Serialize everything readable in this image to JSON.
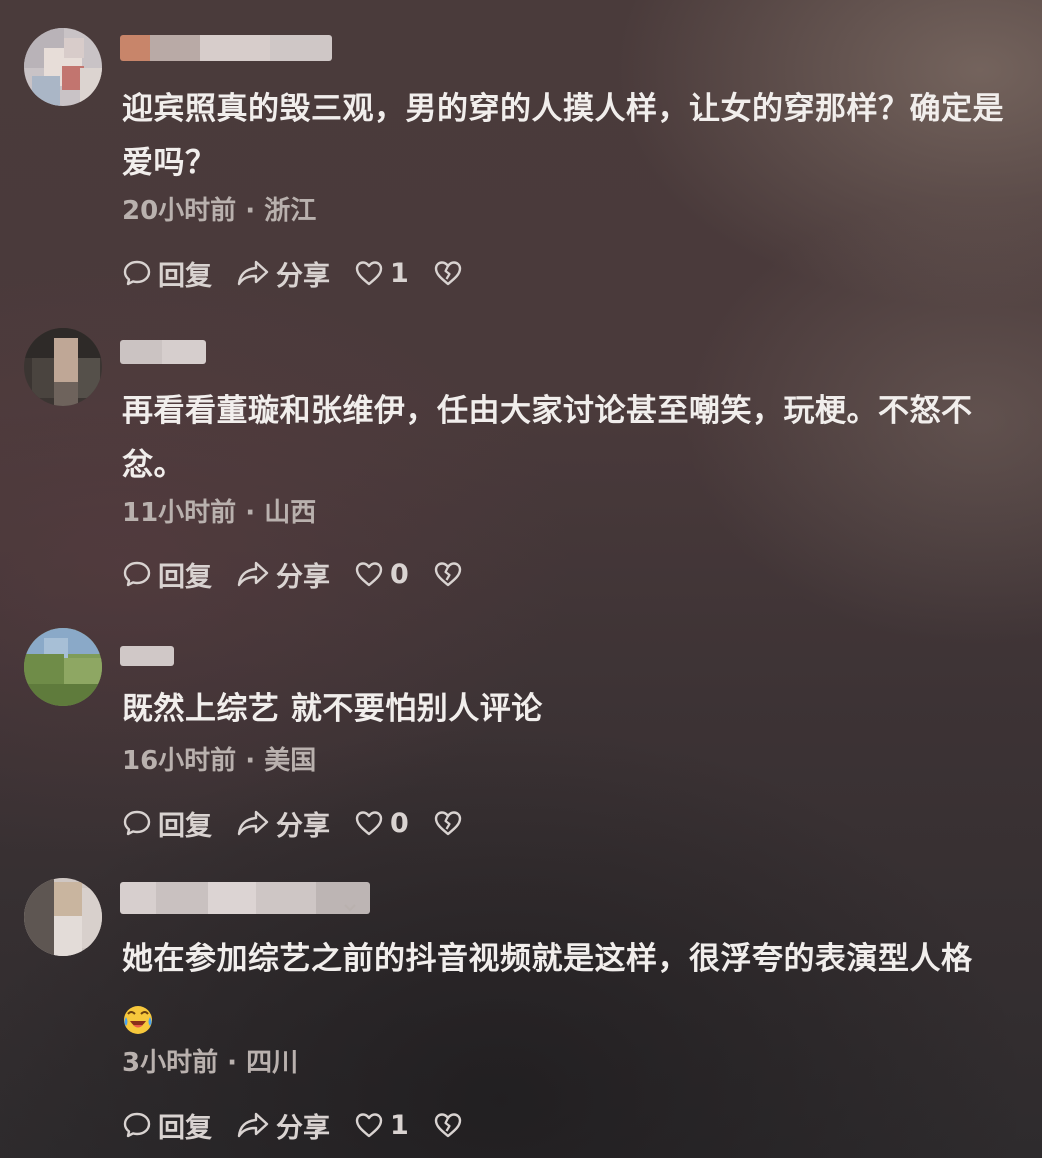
{
  "comments": [
    {
      "text": "迎宾照真的毁三观，男的穿的人摸人样，让女的穿那样？确定是爱吗？",
      "time": "20小时前",
      "location": "浙江",
      "reply_label": "回复",
      "share_label": "分享",
      "likes": "1"
    },
    {
      "text": "再看看董璇和张维伊，任由大家讨论甚至嘲笑，玩梗。不怒不忿。",
      "time": "11小时前",
      "location": "山西",
      "reply_label": "回复",
      "share_label": "分享",
      "likes": "0"
    },
    {
      "text": "既然上综艺 就不要怕别人评论",
      "time": "16小时前",
      "location": "美国",
      "reply_label": "回复",
      "share_label": "分享",
      "likes": "0"
    },
    {
      "text": "她在参加综艺之前的抖音视频就是这样，很浮夸的表演型人格",
      "time": "3小时前",
      "location": "四川",
      "reply_label": "回复",
      "share_label": "分享",
      "likes": "1",
      "emoji": "laughing-crying-emoji"
    }
  ],
  "meta_separator": "·",
  "icons": {
    "reply": "speech-bubble-icon",
    "share": "share-arrow-icon",
    "like": "heart-icon",
    "dislike": "broken-heart-icon",
    "menu": "chevron-down-icon"
  },
  "colors": {
    "text_primary": "#f1eeec",
    "text_secondary": "#b9b1ae",
    "action_text": "#d9d3d1"
  }
}
